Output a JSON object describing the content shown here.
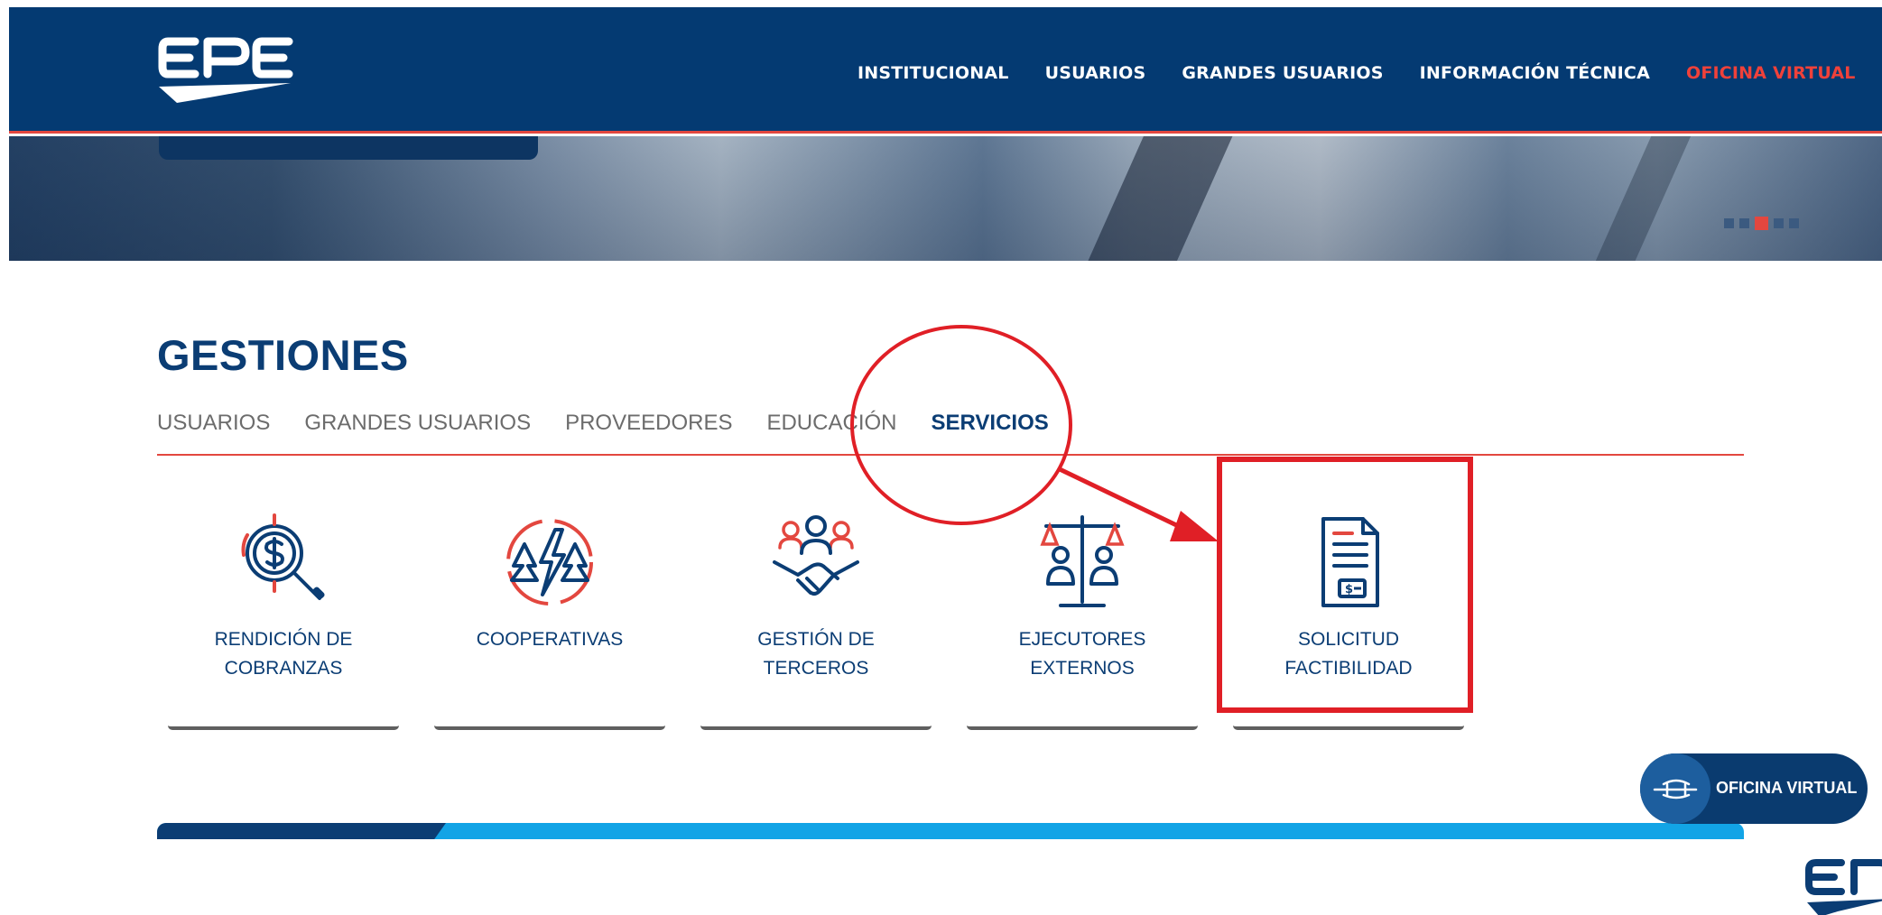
{
  "header": {
    "brand": "EPE",
    "nav": [
      {
        "label": "INSTITUCIONAL"
      },
      {
        "label": "USUARIOS"
      },
      {
        "label": "GRANDES USUARIOS"
      },
      {
        "label": "INFORMACIÓN TÉCNICA"
      },
      {
        "label": "OFICINA VIRTUAL"
      }
    ]
  },
  "hero": {
    "slide_count": 5,
    "active_slide": 3
  },
  "gestiones": {
    "title": "GESTIONES",
    "tabs": [
      {
        "label": "USUARIOS"
      },
      {
        "label": "GRANDES USUARIOS"
      },
      {
        "label": "PROVEEDORES"
      },
      {
        "label": "EDUCACIÓN"
      },
      {
        "label": "SERVICIOS"
      }
    ],
    "active_tab": "SERVICIOS",
    "cards": [
      {
        "line1": "RENDICIÓN DE",
        "line2": "COBRANZAS",
        "icon": "money-search-icon"
      },
      {
        "line1": "COOPERATIVAS",
        "line2": "",
        "icon": "lightning-trees-icon"
      },
      {
        "line1": "GESTIÓN DE",
        "line2": "TERCEROS",
        "icon": "handshake-group-icon"
      },
      {
        "line1": "EJECUTORES",
        "line2": "EXTERNOS",
        "icon": "scales-people-icon"
      },
      {
        "line1": "SOLICITUD",
        "line2": "FACTIBILIDAD",
        "icon": "document-dollar-icon"
      }
    ]
  },
  "floating_button": {
    "label": "OFICINA VIRTUAL",
    "icon": "plane-icon"
  },
  "colors": {
    "header_bg": "#043a72",
    "accent_red": "#e3473f",
    "title_blue": "#0b3d74",
    "annotation_red": "#e01f26",
    "banner_light": "#12a4e6"
  }
}
